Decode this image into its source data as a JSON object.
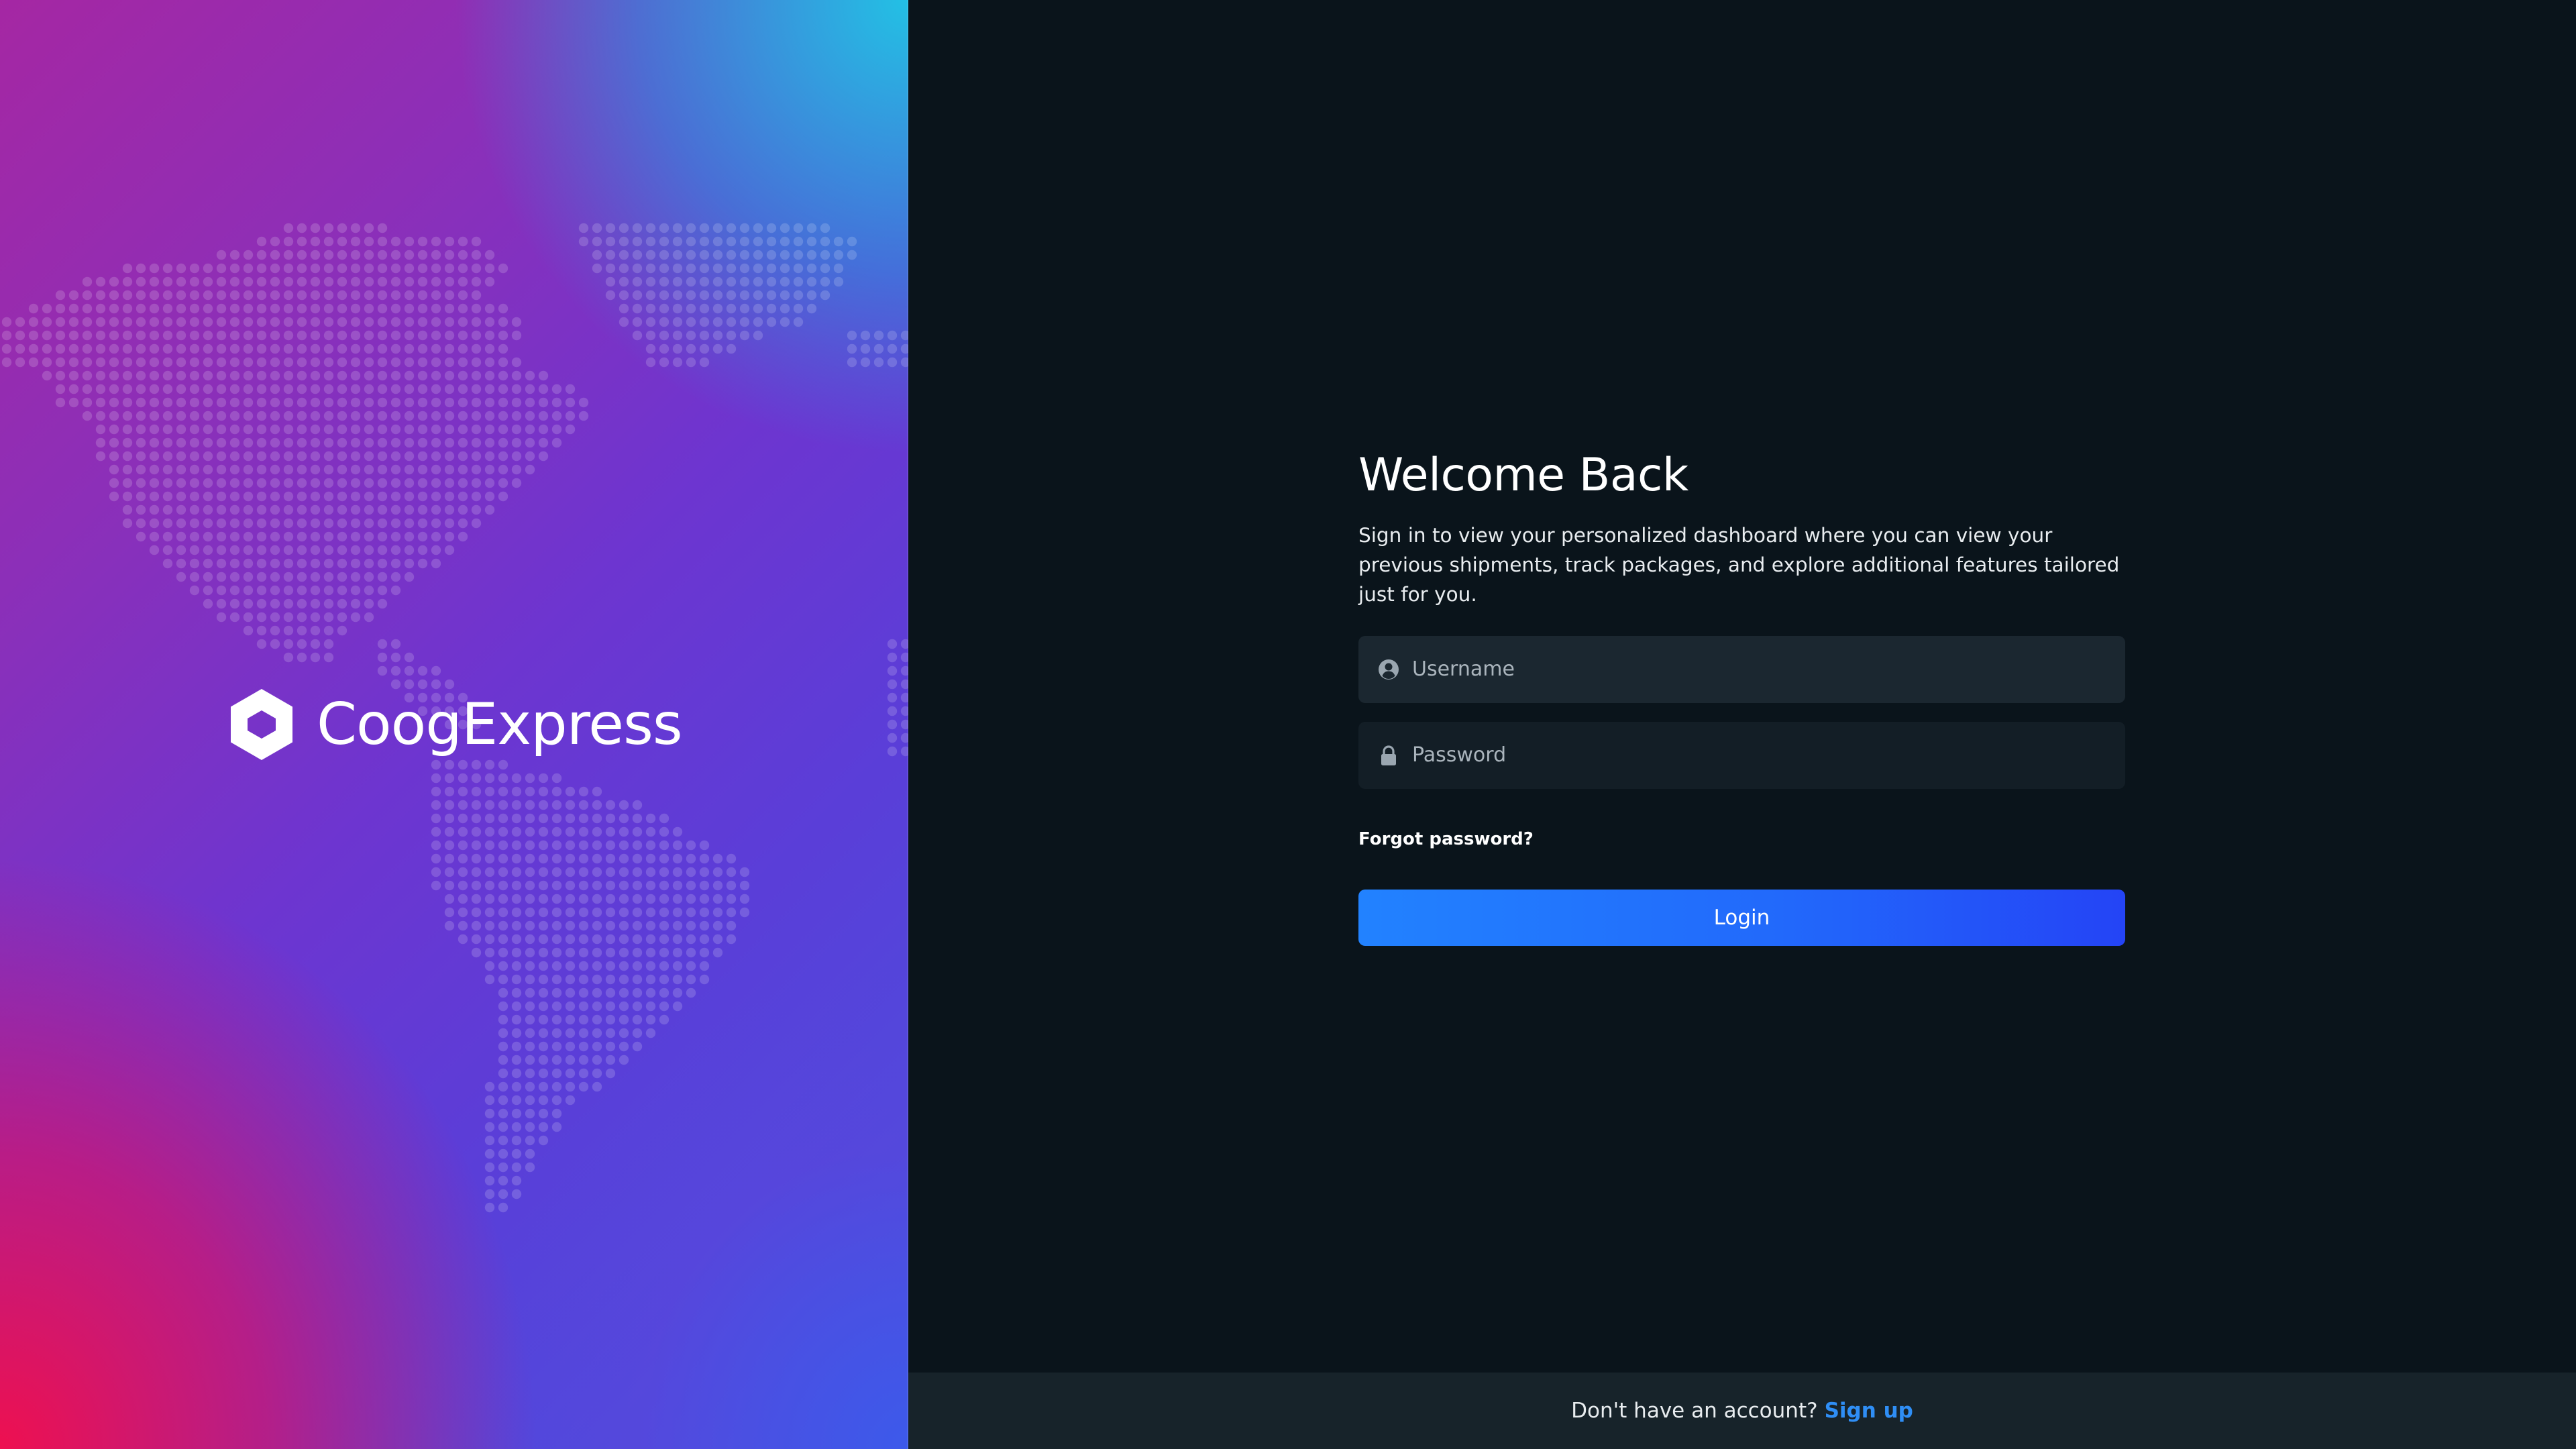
{
  "brand": {
    "name": "CoogExpress",
    "logo_icon": "hexagon-logo-icon",
    "background_decoration": "world-map-dots"
  },
  "login": {
    "title": "Welcome Back",
    "subtitle": "Sign in to view your personalized dashboard where you can view your previous shipments, track packages, and explore additional features tailored just for you.",
    "username": {
      "placeholder": "Username",
      "value": "",
      "icon": "user-circle-icon"
    },
    "password": {
      "placeholder": "Password",
      "value": "",
      "icon": "lock-icon"
    },
    "forgot_label": "Forgot password?",
    "login_label": "Login"
  },
  "footer": {
    "prompt": "Don't have an account?",
    "signup_label": "Sign up"
  },
  "colors": {
    "page_bg": "#0a141b",
    "input_bg": "#1b2730",
    "button_start": "#2282ff",
    "button_end": "#2444f6",
    "link": "#2f8ef5",
    "footer_bg": "#17232a"
  }
}
